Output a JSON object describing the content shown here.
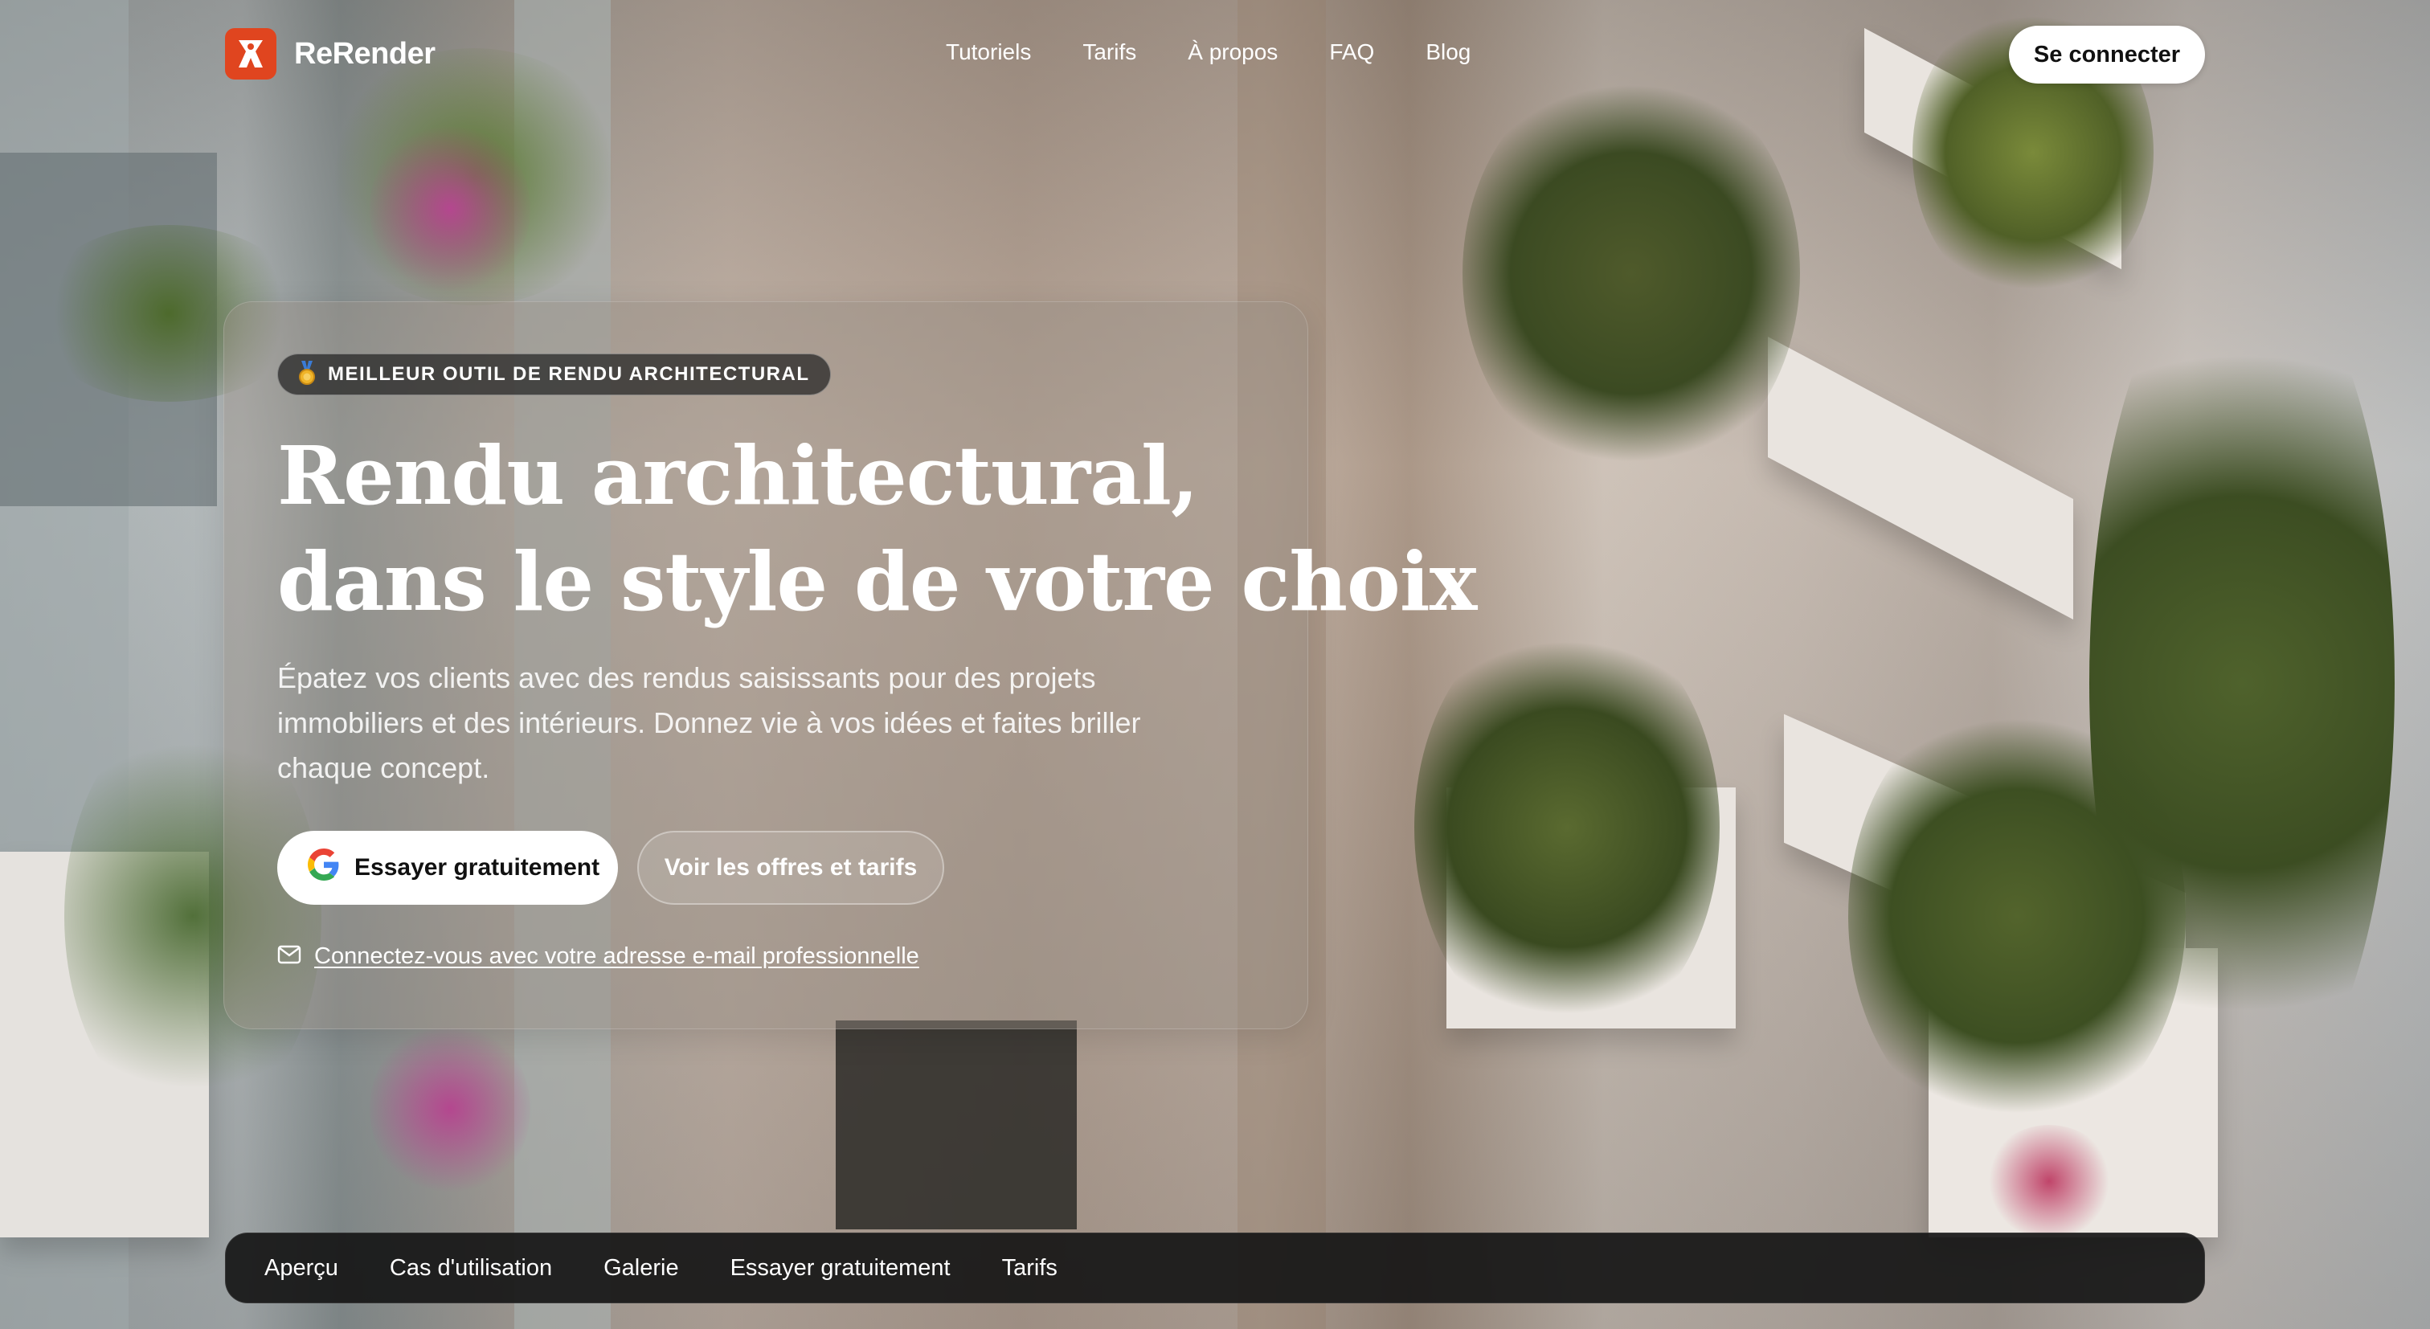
{
  "brand": {
    "name": "ReRender"
  },
  "colors": {
    "brand": "#e0451f",
    "nav_bar": "#161616"
  },
  "nav": {
    "links": [
      "Tutoriels",
      "Tarifs",
      "À propos",
      "FAQ",
      "Blog"
    ],
    "login": "Se connecter"
  },
  "hero": {
    "badge_icon": "medal-icon",
    "badge": "MEILLEUR OUTIL DE RENDU ARCHITECTURAL",
    "title_line1": "Rendu architectural,",
    "title_line2": "dans le style de votre choix",
    "description": "Épatez vos clients avec des rendus saisissants pour des projets immobiliers et des intérieurs. Donnez vie à vos idées et faites briller chaque concept.",
    "cta_primary_icon": "google-icon",
    "cta_primary": "Essayer gratuitement",
    "cta_secondary": "Voir les offres et tarifs",
    "email_icon": "mail-icon",
    "email_link": "Connectez-vous avec votre adresse e-mail professionnelle"
  },
  "section_nav": [
    "Aperçu",
    "Cas d'utilisation",
    "Galerie",
    "Essayer gratuitement",
    "Tarifs"
  ]
}
